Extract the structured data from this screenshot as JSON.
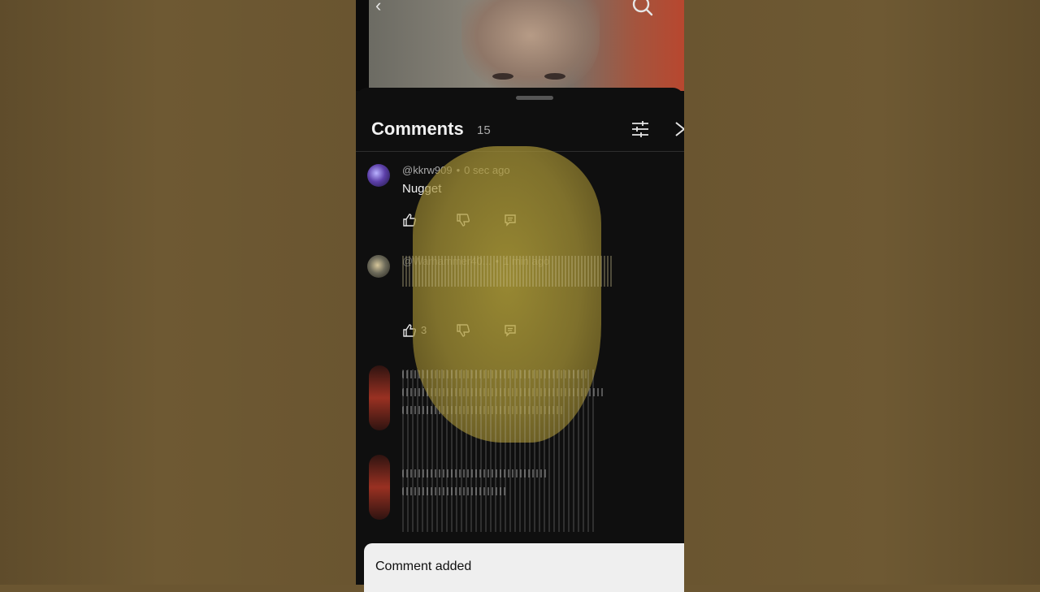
{
  "icons": {
    "back": "chevron-left-icon",
    "search": "search-icon",
    "filter": "sliders-icon",
    "close": "close-icon",
    "like": "thumbs-up-icon",
    "dislike": "thumbs-down-icon",
    "reply": "comment-icon"
  },
  "colors": {
    "sheet_bg": "#0f0f0f",
    "text_primary": "#f1f1f1",
    "text_secondary": "#aaaaaa",
    "toast_bg": "#efefef"
  },
  "comments_panel": {
    "title": "Comments",
    "count": "15"
  },
  "comments": [
    {
      "author": "@kkrw909",
      "time": "0 sec ago",
      "text": "Nugget",
      "likes": ""
    },
    {
      "author": "@Warhammer40...",
      "time": "1 min ago",
      "text": "",
      "likes": "3"
    }
  ],
  "toast": {
    "message": "Comment added"
  }
}
